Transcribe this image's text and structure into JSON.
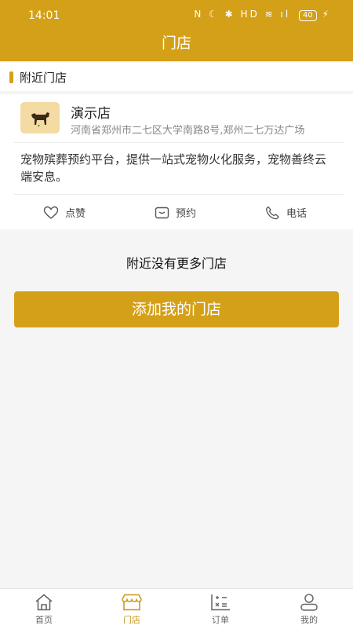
{
  "status_bar": {
    "time": "14:01",
    "indicators": "N ☾ ✱ HD ≋ ıl",
    "battery": "40"
  },
  "header": {
    "title": "门店"
  },
  "section": {
    "title": "附近门店"
  },
  "store": {
    "name": "演示店",
    "address": "河南省郑州市二七区大学南路8号,郑州二七万达广场",
    "description": "宠物殡葬预约平台，提供一站式宠物火化服务，宠物善终云端安息。",
    "logo_icon": "dog-icon"
  },
  "actions": {
    "like_label": "点赞",
    "book_label": "预约",
    "phone_label": "电话"
  },
  "footer_note": "附近没有更多门店",
  "add_button_label": "添加我的门店",
  "tabs": [
    {
      "label": "首页",
      "icon": "home-icon"
    },
    {
      "label": "门店",
      "icon": "store-icon",
      "active": true
    },
    {
      "label": "订单",
      "icon": "order-icon"
    },
    {
      "label": "我的",
      "icon": "user-icon"
    }
  ],
  "colors": {
    "accent": "#d4a017",
    "background": "#f5f5f5"
  }
}
